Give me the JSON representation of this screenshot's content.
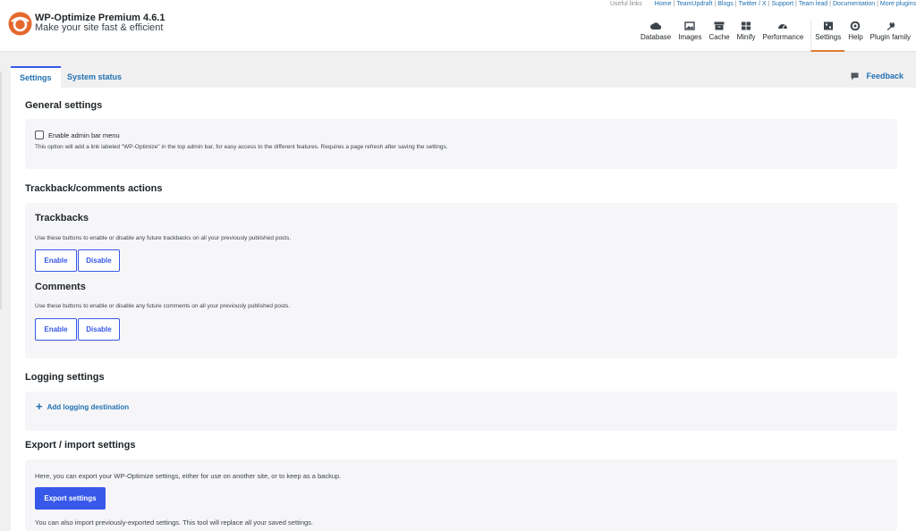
{
  "brand": {
    "title": "WP-Optimize Premium 4.6.1",
    "tagline": "Make your site fast & efficient"
  },
  "useful_links": {
    "label": "Useful links",
    "links": [
      "Home",
      "TeamUpdraft",
      "Blogs",
      "Twitter / X",
      "Support",
      "Team lead",
      "Documentation",
      "More plugins"
    ]
  },
  "nav": {
    "items": [
      {
        "label": "Database",
        "icon": "cloud-icon"
      },
      {
        "label": "Images",
        "icon": "images-icon"
      },
      {
        "label": "Cache",
        "icon": "archive-icon"
      },
      {
        "label": "Minify",
        "icon": "minify-icon"
      },
      {
        "label": "Performance",
        "icon": "gauge-icon"
      },
      {
        "label": "Settings",
        "icon": "settings-grid-icon"
      },
      {
        "label": "Help",
        "icon": "lifebuoy-icon"
      },
      {
        "label": "Plugin family",
        "icon": "plug-icon"
      }
    ],
    "active": "Settings"
  },
  "tabs": {
    "settings": "Settings",
    "system_status": "System status",
    "feedback": "Feedback"
  },
  "general": {
    "title": "General settings",
    "checkbox_label": "Enable admin bar menu",
    "checkbox_checked": false,
    "description": "This option will add a link labeled \"WP-Optimize\" in the top admin bar, for easy access to the different features. Requires a page refresh after saving the settings."
  },
  "trackback_actions": {
    "title": "Trackback/comments actions",
    "trackbacks": {
      "title": "Trackbacks",
      "description": "Use these buttons to enable or disable any future trackbacks on all your previously published posts.",
      "enable": "Enable",
      "disable": "Disable"
    },
    "comments": {
      "title": "Comments",
      "description": "Use these buttons to enable or disable any future comments on all your previously published posts.",
      "enable": "Enable",
      "disable": "Disable"
    }
  },
  "logging": {
    "title": "Logging settings",
    "add_label": "Add logging destination"
  },
  "export_import": {
    "title": "Export / import settings",
    "export_description": "Here, you can export your WP-Optimize settings, either for use on another site, or to keep as a backup.",
    "export_button": "Export settings",
    "import_description": "You can also import previously-exported settings. This tool will replace all your saved settings."
  },
  "colors": {
    "accent": "#3858e9",
    "link": "#2271b1",
    "brand": "#e07a35"
  }
}
